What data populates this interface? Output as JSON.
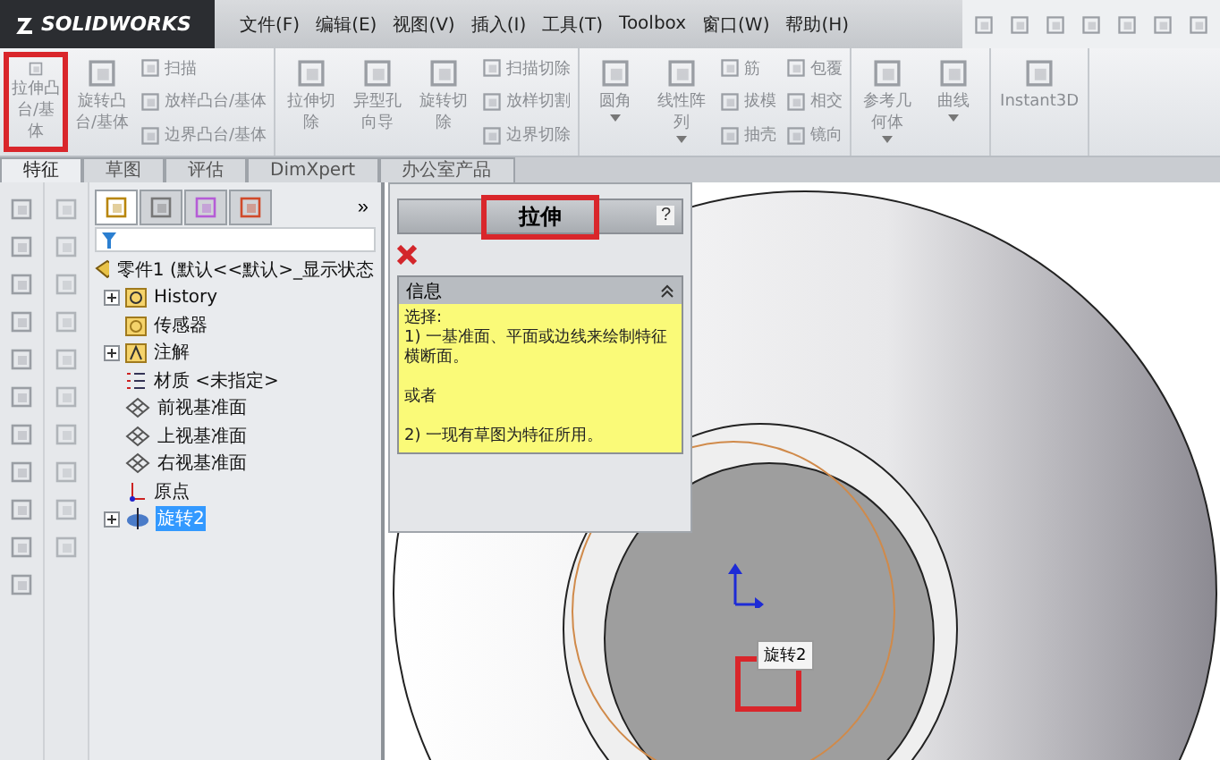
{
  "app": {
    "logo": "SOLIDWORKS"
  },
  "menu": [
    "文件(F)",
    "编辑(E)",
    "视图(V)",
    "插入(I)",
    "工具(T)",
    "Toolbox",
    "窗口(W)",
    "帮助(H)"
  ],
  "toolbar": {
    "groups": [
      {
        "items": [
          {
            "kind": "large",
            "label": "拉伸凸台/基体",
            "highlighted": true,
            "dropdown": false
          },
          {
            "kind": "large",
            "label": "旋转凸台/基体",
            "highlighted": false,
            "dropdown": false
          },
          {
            "kind": "column",
            "labels": [
              "扫描",
              "放样凸台/基体",
              "边界凸台/基体"
            ]
          }
        ]
      },
      {
        "items": [
          {
            "kind": "large",
            "label": "拉伸切除",
            "highlighted": false,
            "dropdown": false
          },
          {
            "kind": "large",
            "label": "异型孔向导",
            "highlighted": false,
            "dropdown": false
          },
          {
            "kind": "large",
            "label": "旋转切除",
            "highlighted": false,
            "dropdown": false
          },
          {
            "kind": "column",
            "labels": [
              "扫描切除",
              "放样切割",
              "边界切除"
            ]
          }
        ]
      },
      {
        "items": [
          {
            "kind": "large",
            "label": "圆角",
            "highlighted": false,
            "dropdown": true
          },
          {
            "kind": "large",
            "label": "线性阵列",
            "highlighted": false,
            "dropdown": true
          },
          {
            "kind": "column",
            "labels": [
              "筋",
              "拔模",
              "抽壳"
            ]
          },
          {
            "kind": "column",
            "labels": [
              "包覆",
              "相交",
              "镜向"
            ]
          }
        ]
      },
      {
        "items": [
          {
            "kind": "large",
            "label": "参考几何体",
            "highlighted": false,
            "dropdown": true
          },
          {
            "kind": "large",
            "label": "曲线",
            "highlighted": false,
            "dropdown": true
          }
        ]
      },
      {
        "items": [
          {
            "kind": "large",
            "label": "Instant3D",
            "highlighted": false,
            "dropdown": false
          }
        ]
      }
    ]
  },
  "tabs": [
    {
      "label": "特征",
      "selected": true
    },
    {
      "label": "草图",
      "selected": false
    },
    {
      "label": "评估",
      "selected": false
    },
    {
      "label": "DimXpert",
      "selected": false
    },
    {
      "label": "办公室产品",
      "selected": false
    }
  ],
  "manager_tabs": [
    {
      "selected": true
    },
    {
      "selected": false
    },
    {
      "selected": false
    },
    {
      "selected": false
    }
  ],
  "manager_more": "»",
  "tree": {
    "label": "零件1  (默认<<默认>_显示状态",
    "children": [
      {
        "kind": "history",
        "label": "History",
        "expandable": true,
        "selected": false
      },
      {
        "kind": "sensor",
        "label": "传感器",
        "expandable": false,
        "selected": false
      },
      {
        "kind": "annotation",
        "label": "注解",
        "expandable": true,
        "selected": false
      },
      {
        "kind": "material",
        "label": "材质 <未指定>",
        "expandable": false,
        "selected": false
      },
      {
        "kind": "plane",
        "label": "前视基准面",
        "expandable": false,
        "selected": false
      },
      {
        "kind": "plane",
        "label": "上视基准面",
        "expandable": false,
        "selected": false
      },
      {
        "kind": "plane",
        "label": "右视基准面",
        "expandable": false,
        "selected": false
      },
      {
        "kind": "origin",
        "label": "原点",
        "expandable": false,
        "selected": false
      },
      {
        "kind": "feature",
        "label": "旋转2",
        "expandable": true,
        "selected": true
      }
    ]
  },
  "property_manager": {
    "title": "拉伸",
    "title_highlighted": true,
    "help": "?",
    "section": {
      "title": "信息",
      "expanded": true,
      "paragraphs": [
        [
          "选择:",
          "1) 一基准面、平面或边线来绘制特征横断面。"
        ],
        [
          "或者"
        ],
        [
          "2) 一现有草图为特征所用。"
        ]
      ]
    }
  },
  "viewport": {
    "tooltip": "旋转2"
  }
}
